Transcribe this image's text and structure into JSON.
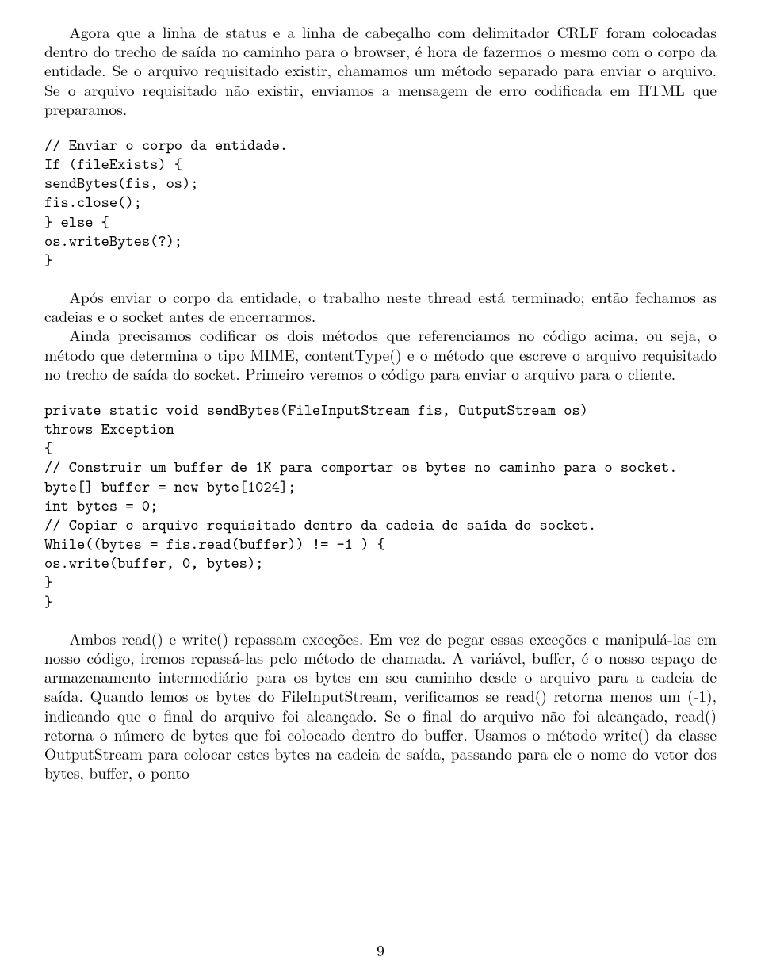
{
  "para1": "Agora que a linha de status e a linha de cabeçalho com delimitador CRLF foram colocadas dentro do trecho de saída no caminho para o browser, é hora de fazermos o mesmo com o corpo da entidade. Se o arquivo requisitado existir, chamamos um método separado para enviar o arquivo. Se o arquivo requisitado não existir, enviamos a mensagem de erro codificada em HTML que preparamos.",
  "code1": "// Enviar o corpo da entidade.\nIf (fileExists) {\nsendBytes(fis, os);\nfis.close();\n} else {\nos.writeBytes(?);\n}",
  "para2": "Após enviar o corpo da entidade, o trabalho neste thread está terminado; então fechamos as cadeias e o socket antes de encerrarmos.",
  "para3": "Ainda precisamos codificar os dois métodos que referenciamos no código acima, ou seja, o método que determina o tipo MIME, contentType() e o método que escreve o arquivo requisitado no trecho de saída do socket. Primeiro veremos o código para enviar o arquivo para o cliente.",
  "code2": "private static void sendBytes(FileInputStream fis, OutputStream os)\nthrows Exception\n{\n// Construir um buffer de 1K para comportar os bytes no caminho para o socket.\nbyte[] buffer = new byte[1024];\nint bytes = 0;\n// Copiar o arquivo requisitado dentro da cadeia de saída do socket.\nWhile((bytes = fis.read(buffer)) != -1 ) {\nos.write(buffer, 0, bytes);\n}\n}",
  "para4": "Ambos read() e write() repassam exceções. Em vez de pegar essas exceções e manipulá-las em nosso código, iremos repassá-las pelo método de chamada. A variável, buffer, é o nosso espaço de armazenamento intermediário para os bytes em seu caminho desde o arquivo para a cadeia de saída. Quando lemos os bytes do FileInputStream, verificamos se read() retorna menos um (-1), indicando que o final do arquivo foi alcançado. Se o final do arquivo não foi alcançado, read() retorna o número de bytes que foi colocado dentro do buffer. Usamos o método write() da classe OutputStream para colocar estes bytes na cadeia de saída, passando para ele o nome do vetor dos bytes, buffer, o ponto",
  "page_number": "9"
}
